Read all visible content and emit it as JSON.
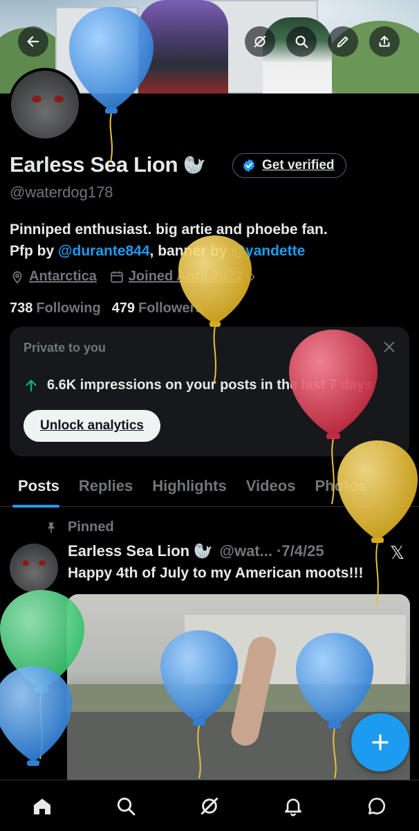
{
  "header": {
    "back_icon": "arrow-left-icon",
    "grok_icon": "grok-icon",
    "search_icon": "search-icon",
    "edit_icon": "pencil-icon",
    "share_icon": "share-icon"
  },
  "profile": {
    "display_name": "Earless Sea Lion",
    "name_emoji": "🦭",
    "handle": "@waterdog178",
    "verify_label": "Get verified",
    "bio_text_1": "Pinniped enthusiast. big artie and phoebe fan.",
    "bio_pfp_prefix": "Pfp by ",
    "bio_pfp_link": "@durante844",
    "bio_banner_prefix": ", banner by ",
    "bio_banner_link": "@yandette",
    "location": "Antarctica",
    "joined": "Joined April 2022",
    "following_count": "738",
    "following_label": "Following",
    "followers_count": "479",
    "followers_label": "Followers"
  },
  "private_card": {
    "title": "Private to you",
    "stat": "6.6K impressions on your posts in the last 7 days",
    "button": "Unlock analytics"
  },
  "tabs": [
    {
      "label": "Posts",
      "active": true
    },
    {
      "label": "Replies"
    },
    {
      "label": "Highlights"
    },
    {
      "label": "Videos"
    },
    {
      "label": "Photos"
    }
  ],
  "post": {
    "pinned_label": "Pinned",
    "author": "Earless Sea Lion",
    "author_emoji": "🦭",
    "meta": "@wat... ·7/4/25",
    "x_logo": "𝕏",
    "text": "Happy 4th of July to my American moots!!!"
  },
  "colors": {
    "accent": "#1d9bf0",
    "background": "#000000",
    "balloon_blue": "#3b8fe8",
    "balloon_yellow": "#e8c13a",
    "balloon_red": "#d9384f",
    "balloon_green": "#3fcf7a"
  },
  "bottom_nav": [
    "home-icon",
    "search-icon",
    "grok-icon",
    "bell-icon",
    "chat-icon"
  ]
}
